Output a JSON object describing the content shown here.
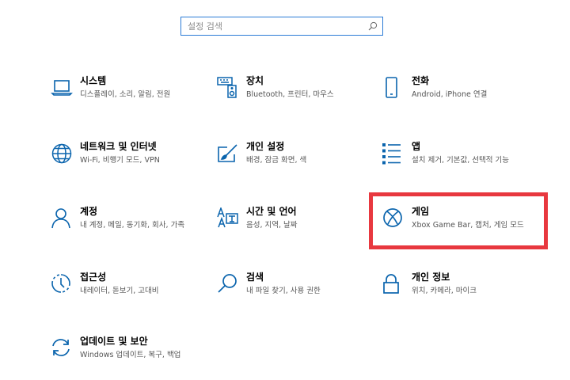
{
  "search": {
    "placeholder": "설정 검색",
    "value": ""
  },
  "items": [
    {
      "title": "시스템",
      "desc": "디스플레이, 소리, 알림, 전원",
      "icon": "laptop-icon"
    },
    {
      "title": "장치",
      "desc": "Bluetooth, 프린터, 마우스",
      "icon": "keyboard-speaker-icon"
    },
    {
      "title": "전화",
      "desc": "Android, iPhone 연결",
      "icon": "phone-icon"
    },
    {
      "title": "네트워크 및 인터넷",
      "desc": "Wi-Fi, 비행기 모드, VPN",
      "icon": "globe-icon"
    },
    {
      "title": "개인 설정",
      "desc": "배경, 잠금 화면, 색",
      "icon": "paint-brush-icon"
    },
    {
      "title": "앱",
      "desc": "설치 제거, 기본값, 선택적 기능",
      "icon": "apps-list-icon"
    },
    {
      "title": "계정",
      "desc": "내 계정, 메일, 동기화, 회사, 가족",
      "icon": "person-icon"
    },
    {
      "title": "시간 및 언어",
      "desc": "음성, 지역, 날짜",
      "icon": "language-icon"
    },
    {
      "title": "게임",
      "desc": "Xbox Game Bar, 캡처, 게임 모드",
      "icon": "xbox-icon"
    },
    {
      "title": "접근성",
      "desc": "내레이터, 돋보기, 고대비",
      "icon": "accessibility-icon"
    },
    {
      "title": "검색",
      "desc": "내 파일 찾기, 사용 권한",
      "icon": "search-icon"
    },
    {
      "title": "개인 정보",
      "desc": "위치, 카메라, 마이크",
      "icon": "lock-icon"
    },
    {
      "title": "업데이트 및 보안",
      "desc": "Windows 업데이트, 복구, 백업",
      "icon": "sync-icon"
    }
  ],
  "colors": {
    "accent": "#0a64ad",
    "highlight": "#e8383f",
    "search_border": "#2b7bd6"
  }
}
